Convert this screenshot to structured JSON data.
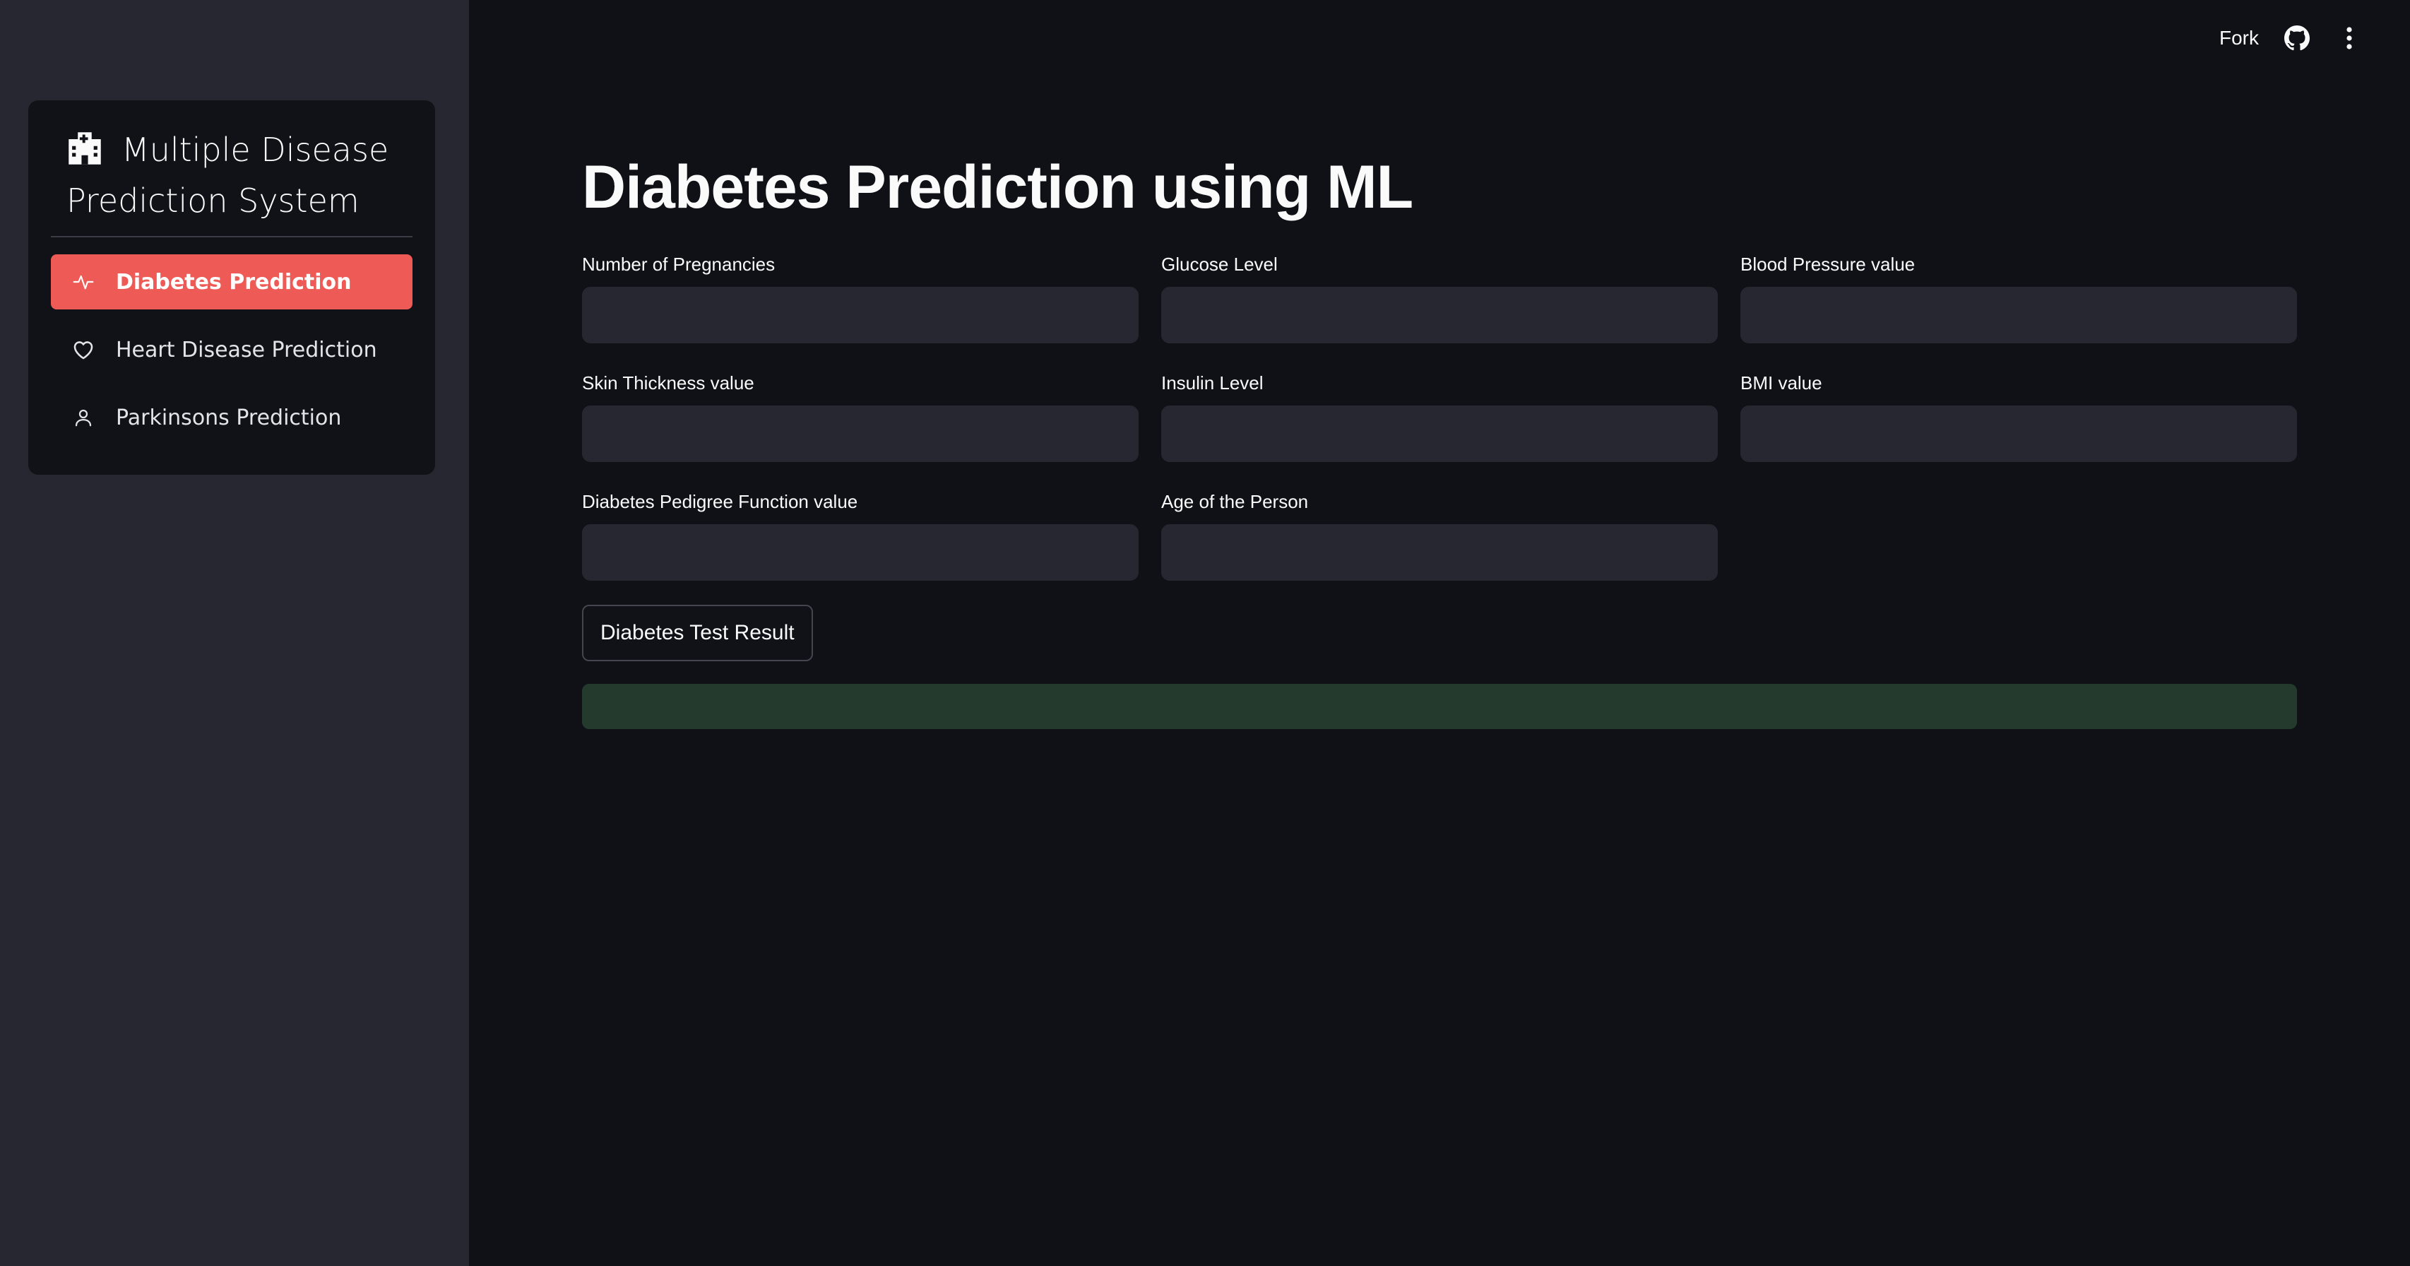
{
  "sidebar": {
    "menu_title": "Multiple Disease Prediction System",
    "menu_title_icon": "hospital-icon",
    "items": [
      {
        "label": "Diabetes Prediction",
        "icon": "activity-icon",
        "active": true
      },
      {
        "label": "Heart Disease Prediction",
        "icon": "heart-icon",
        "active": false
      },
      {
        "label": "Parkinsons Prediction",
        "icon": "person-icon",
        "active": false
      }
    ],
    "accent_color": "#ee5b56"
  },
  "toolbar": {
    "fork_label": "Fork",
    "github_icon": "github-icon",
    "menu_icon": "kebab-menu-icon"
  },
  "main": {
    "title": "Diabetes Prediction using ML",
    "fields": [
      {
        "label": "Number of Pregnancies",
        "value": ""
      },
      {
        "label": "Glucose Level",
        "value": ""
      },
      {
        "label": "Blood Pressure value",
        "value": ""
      },
      {
        "label": "Skin Thickness value",
        "value": ""
      },
      {
        "label": "Insulin Level",
        "value": ""
      },
      {
        "label": "BMI value",
        "value": ""
      },
      {
        "label": "Diabetes Pedigree Function value",
        "value": ""
      },
      {
        "label": "Age of the Person",
        "value": ""
      }
    ],
    "submit_label": "Diabetes Test Result",
    "result_text": "",
    "result_color": "#243a2d"
  }
}
